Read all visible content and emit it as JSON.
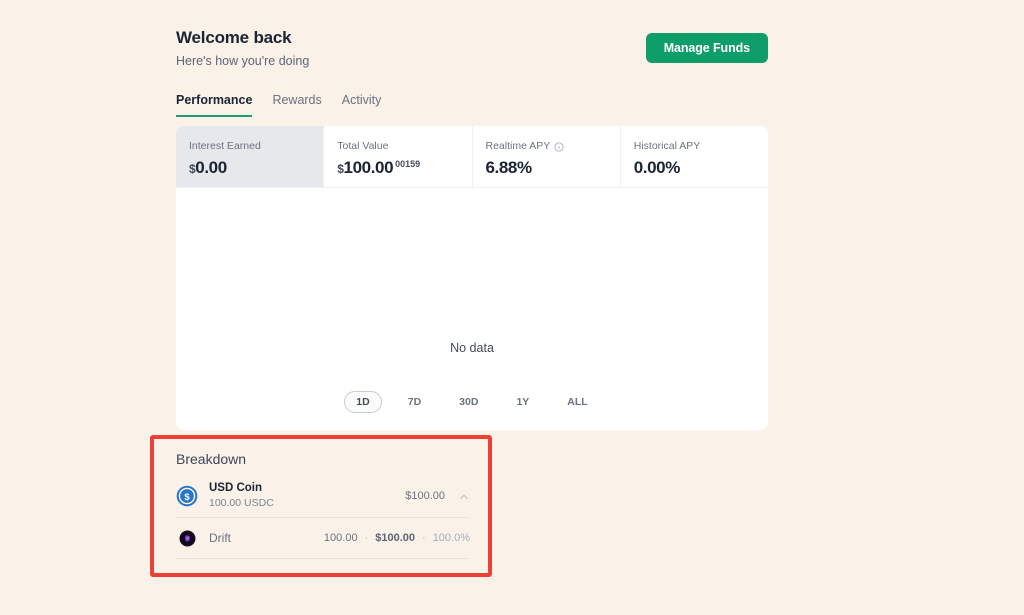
{
  "theme": {
    "page_background": "#faf1e9",
    "card_background": "#ffffff",
    "accent_green": "#0f9d6a",
    "tab_underline": "#18a06f",
    "annotation_red": "#ef4036",
    "highlight_stat_background": "#e7e8ec",
    "usdc_blue": "#2775ca"
  },
  "header": {
    "title": "Welcome back",
    "subtitle": "Here's how you're doing",
    "manage_funds_label": "Manage Funds"
  },
  "tabs": [
    {
      "label": "Performance",
      "active": true
    },
    {
      "label": "Rewards",
      "active": false
    },
    {
      "label": "Activity",
      "active": false
    }
  ],
  "stats": [
    {
      "label": "Interest Earned",
      "currency": "$",
      "value": "0.00",
      "superscript": "",
      "has_info": false,
      "highlighted": true
    },
    {
      "label": "Total Value",
      "currency": "$",
      "value": "100.00",
      "superscript": "00159",
      "has_info": false,
      "highlighted": false
    },
    {
      "label": "Realtime APY",
      "currency": "",
      "value": "6.88%",
      "superscript": "",
      "has_info": true,
      "highlighted": false
    },
    {
      "label": "Historical APY",
      "currency": "",
      "value": "0.00%",
      "superscript": "",
      "has_info": false,
      "highlighted": false
    }
  ],
  "chart": {
    "empty_message": "No data",
    "ranges": [
      {
        "label": "1D",
        "active": true
      },
      {
        "label": "7D",
        "active": false
      },
      {
        "label": "30D",
        "active": false
      },
      {
        "label": "1Y",
        "active": false
      },
      {
        "label": "ALL",
        "active": false
      }
    ]
  },
  "breakdown": {
    "title": "Breakdown",
    "asset": {
      "icon": "usdc-icon",
      "name": "USD Coin",
      "balance": "100.00 USDC",
      "value": "$100.00",
      "expand_icon": "chevron-up-icon"
    },
    "positions": [
      {
        "icon": "drift-icon",
        "name": "Drift",
        "amount": "100.00",
        "separator": "·",
        "value": "$100.00",
        "share": "100.0%"
      }
    ]
  }
}
